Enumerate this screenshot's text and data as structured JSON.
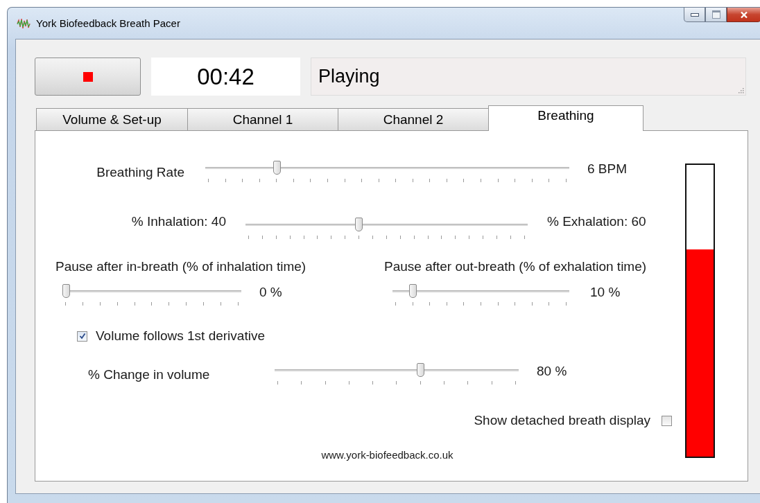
{
  "window": {
    "title": "York Biofeedback Breath Pacer"
  },
  "toolbar": {
    "timer": "00:42",
    "status": "Playing"
  },
  "tabs": [
    {
      "label": "Volume & Set-up",
      "selected": false
    },
    {
      "label": "Channel 1",
      "selected": false
    },
    {
      "label": "Channel 2",
      "selected": false
    },
    {
      "label": "Breathing",
      "selected": true
    }
  ],
  "breathing_rate": {
    "label": "Breathing Rate",
    "level": 0.19,
    "reading": "6 BPM"
  },
  "inhalation": {
    "label": "% Inhalation: 40",
    "level": 0.4,
    "reading": "% Exhalation: 60"
  },
  "pause_in": {
    "label": "Pause after in-breath (% of inhalation time)",
    "level": 0,
    "reading": "0 %"
  },
  "pause_out": {
    "label": "Pause after out-breath (% of exhalation time)",
    "level": 0.1,
    "reading": "10 %"
  },
  "follow_derivative": {
    "label": "Volume follows 1st derivative",
    "checked": true
  },
  "volume_change": {
    "label": "% Change in volume",
    "level": 0.6,
    "reading": "80 %"
  },
  "detached_display": {
    "label": "Show detached breath display",
    "checked": false
  },
  "breath_display": {
    "level": 0.71
  },
  "footer": {
    "url": "www.york-biofeedback.co.uk"
  }
}
